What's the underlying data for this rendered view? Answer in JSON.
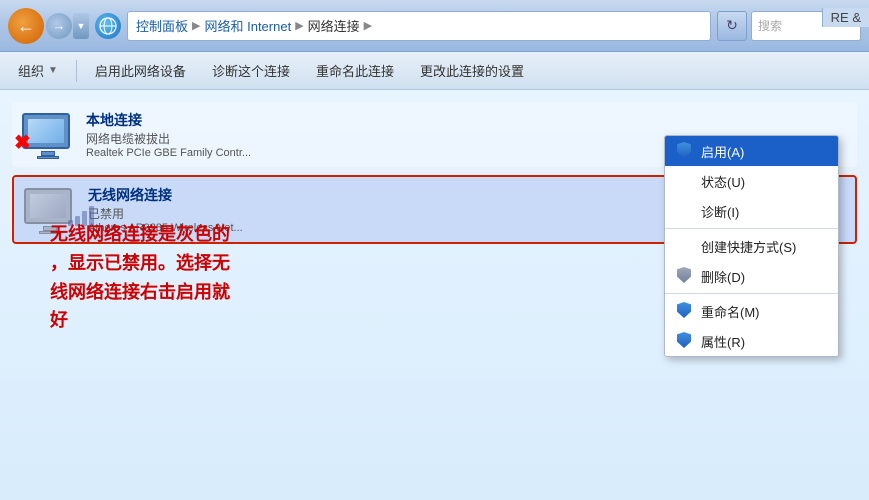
{
  "titlebar": {
    "back_title": "←",
    "forward_title": "→",
    "dropdown_title": "▼",
    "refresh_icon": "↻",
    "search_placeholder": "搜索"
  },
  "breadcrumb": {
    "items": [
      "控制面板",
      "网络和 Internet",
      "网络连接"
    ],
    "separator": "▶"
  },
  "toolbar": {
    "organize_label": "组织",
    "enable_label": "启用此网络设备",
    "diagnose_label": "诊断这个连接",
    "rename_label": "重命名此连接",
    "change_settings_label": "更改此连接的设置",
    "dropdown_char": "▼"
  },
  "connections": {
    "local": {
      "name": "本地连接",
      "status": "网络电缆被拔出",
      "adapter": "Realtek PCIe GBE Family Contr..."
    },
    "wireless": {
      "name": "无线网络连接",
      "status": "已禁用",
      "adapter": "Atheros AR9285 Wireless Net..."
    }
  },
  "context_menu": {
    "items": [
      {
        "label": "启用(A)",
        "has_shield": true,
        "highlighted": true
      },
      {
        "label": "状态(U)",
        "has_shield": false,
        "highlighted": false
      },
      {
        "label": "诊断(I)",
        "has_shield": false,
        "highlighted": false
      },
      {
        "separator": true
      },
      {
        "label": "创建快捷方式(S)",
        "has_shield": false,
        "highlighted": false
      },
      {
        "label": "删除(D)",
        "has_shield": true,
        "highlighted": false
      },
      {
        "separator": true
      },
      {
        "label": "重命名(M)",
        "has_shield": true,
        "highlighted": false
      },
      {
        "label": "属性(R)",
        "has_shield": true,
        "highlighted": false
      }
    ]
  },
  "annotation": {
    "text_line1": "无线网络连接是灰色的",
    "text_line2": "，显示已禁用。选择无",
    "text_line3": "线网络连接右击启用就",
    "text_line4": "好"
  },
  "topright": {
    "text": "RE &"
  }
}
